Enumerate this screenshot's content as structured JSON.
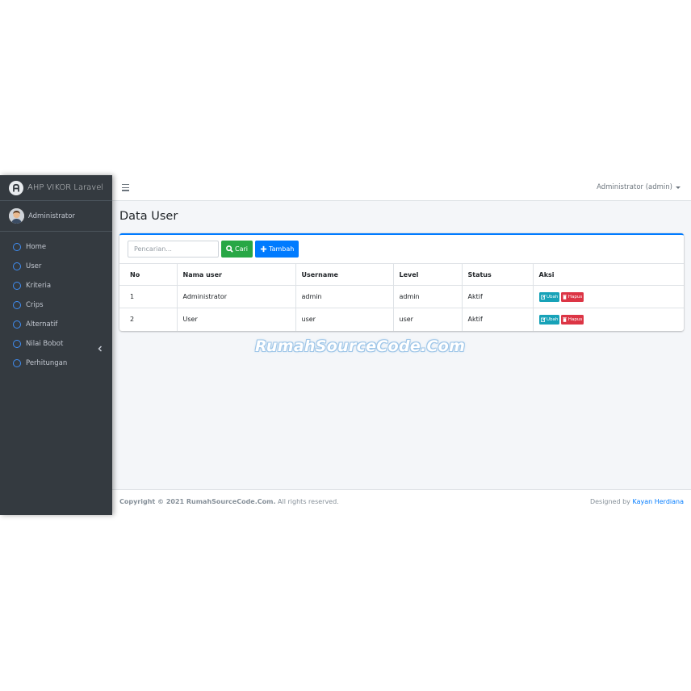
{
  "brand": {
    "title": "AHP VIKOR Laravel"
  },
  "user_panel": {
    "name": "Administrator"
  },
  "sidebar": {
    "items": [
      {
        "label": "Home"
      },
      {
        "label": "User"
      },
      {
        "label": "Kriteria"
      },
      {
        "label": "Crips"
      },
      {
        "label": "Alternatif"
      },
      {
        "label": "Nilai Bobot"
      },
      {
        "label": "Perhitungan"
      }
    ]
  },
  "topbar": {
    "user_menu": "Administrator (admin)"
  },
  "page": {
    "title": "Data User"
  },
  "search": {
    "placeholder": "Pencarian...",
    "value": ""
  },
  "toolbar": {
    "cari_label": "Cari",
    "tambah_label": "Tambah"
  },
  "table": {
    "headers": [
      "No",
      "Nama user",
      "Username",
      "Level",
      "Status",
      "Aksi"
    ],
    "rows": [
      {
        "no": "1",
        "nama": "Administrator",
        "username": "admin",
        "level": "admin",
        "status": "Aktif"
      },
      {
        "no": "2",
        "nama": "User",
        "username": "user",
        "level": "user",
        "status": "Aktif"
      }
    ],
    "edit_label": "Ubah",
    "delete_label": "Hapus"
  },
  "watermark": "RumahSourceCode.Com",
  "footer": {
    "copyright_bold": "Copyright © 2021 RumahSourceCode.Com.",
    "copyright_rest": " All rights reserved.",
    "designed_by": "Designed by ",
    "designer": "Kayan Herdiana"
  },
  "colors": {
    "sidebar_bg": "#343a40",
    "primary": "#007bff",
    "success": "#28a745",
    "info": "#17a2b8",
    "danger": "#dc3545",
    "nav_icon": "#3f8ef5"
  },
  "icons": {
    "brand": "brand-logo-icon",
    "nav": "circle-outline-icon",
    "nilai_bobot_expand": "chevron-left-icon",
    "search": "search-icon",
    "add": "plus-icon",
    "edit": "edit-icon",
    "delete": "trash-icon",
    "menu": "hamburger-icon"
  }
}
